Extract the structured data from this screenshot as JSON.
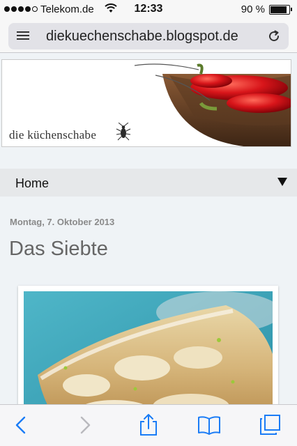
{
  "status_bar": {
    "carrier": "Telekom.de",
    "time": "12:33",
    "battery_percent": "90 %",
    "battery_level": 0.9,
    "signal_bars": 4
  },
  "browser": {
    "url": "diekuechenschabe.blogspot.de",
    "icons": [
      "menu-icon",
      "reload-icon"
    ]
  },
  "blog": {
    "brand": "die küchenschabe",
    "nav_home": "Home",
    "post": {
      "date": "Montag, 7. Oktober 2013",
      "title": "Das Siebte"
    }
  },
  "toolbar": {
    "icons": [
      "back-icon",
      "forward-icon",
      "share-icon",
      "bookmarks-icon",
      "tabs-icon"
    ]
  },
  "colors": {
    "ios_blue": "#1a7cf6",
    "title_gray": "#666666",
    "date_gray": "#8a8a8a"
  }
}
